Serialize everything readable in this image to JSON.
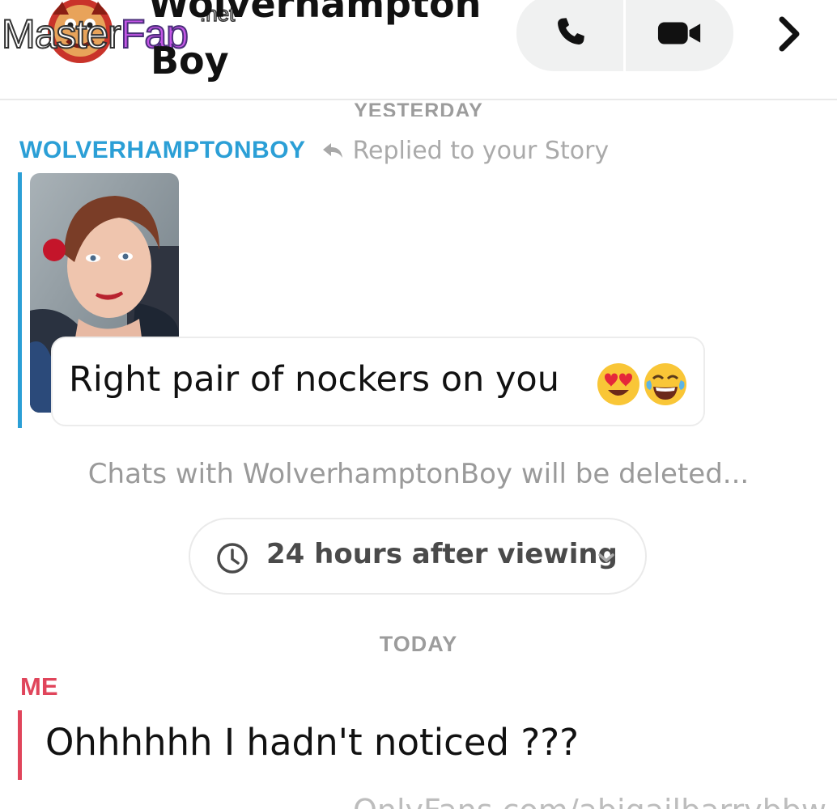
{
  "header": {
    "title_line1": "Wolverhampton",
    "title_line2": "Boy",
    "call_icon": "phone-icon",
    "video_icon": "video-camera-icon",
    "more_icon": "chevron-right-icon"
  },
  "watermark": {
    "master": "Master",
    "fap": "Fap",
    "net": ".net",
    "footer_text": "OnlyFans.com/abigailbarrybbw"
  },
  "chat": {
    "day_yesterday": "YESTERDAY",
    "sender_name": "WOLVERHAMPTONBOY",
    "reply_label": "Replied to your Story",
    "message_text": "Right pair of nockers on you",
    "emojis": [
      "heart-eyes-emoji",
      "tears-of-joy-emoji"
    ],
    "deletion_notice": "Chats with WolverhamptonBoy will be deleted...",
    "timer_label": "24 hours after viewing",
    "day_today": "TODAY",
    "me_label": "ME",
    "my_message": "Ohhhhhh I hadn't noticed ???"
  },
  "colors": {
    "sender_blue": "#2b9fd6",
    "me_red": "#e0455b",
    "muted_gray": "#9a9a9a"
  }
}
